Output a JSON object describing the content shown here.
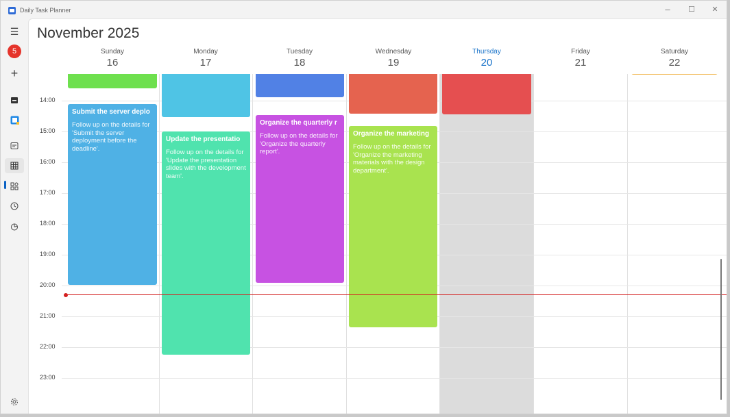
{
  "app": {
    "title": "Daily Task Planner"
  },
  "window_controls": {
    "minimize": "–",
    "maximize": "☐",
    "close": "✕"
  },
  "nav": {
    "menu_icon": "☰",
    "badge": "5",
    "add_icon": "+",
    "items": [
      {
        "icon": "calendar-today-icon"
      },
      {
        "icon": "google-calendar-icon"
      },
      {
        "icon": "agenda-icon"
      },
      {
        "icon": "week-grid-icon",
        "selected": true
      },
      {
        "icon": "widgets-icon"
      },
      {
        "icon": "clock-icon"
      },
      {
        "icon": "pie-chart-icon"
      }
    ],
    "settings_icon": "gear-icon"
  },
  "calendar": {
    "month_label": "November 2025",
    "days": [
      {
        "name": "Sunday",
        "num": "16"
      },
      {
        "name": "Monday",
        "num": "17"
      },
      {
        "name": "Tuesday",
        "num": "18"
      },
      {
        "name": "Wednesday",
        "num": "19"
      },
      {
        "name": "Thursday",
        "num": "20",
        "today": true
      },
      {
        "name": "Friday",
        "num": "21"
      },
      {
        "name": "Saturday",
        "num": "22"
      }
    ],
    "times": [
      "14:00",
      "15:00",
      "16:00",
      "17:00",
      "18:00",
      "19:00",
      "20:00",
      "21:00",
      "22:00",
      "23:00"
    ],
    "current_time_line": true
  },
  "events": [
    {
      "day": "Sunday",
      "title": "",
      "description": "",
      "color": "#6ee04e"
    },
    {
      "day": "Sunday",
      "title": "Submit the server deplo",
      "description": "Follow up on the details for 'Submit the server deployment before the deadline'.",
      "color": "#4fb1e5"
    },
    {
      "day": "Monday",
      "title": "",
      "description": "",
      "color": "#4fc4e5"
    },
    {
      "day": "Monday",
      "title": "Update the presentatio",
      "description": "Follow up on the details for 'Update the presentation slides with the development team'.",
      "color": "#50e3ae"
    },
    {
      "day": "Tuesday",
      "title": "",
      "description": "",
      "color": "#5181e5"
    },
    {
      "day": "Tuesday",
      "title": "Organize the quarterly r",
      "description": "Follow up on the details for 'Organize the quarterly report'.",
      "color": "#c752e2"
    },
    {
      "day": "Wednesday",
      "title": "",
      "description": "",
      "color": "#e5634f"
    },
    {
      "day": "Wednesday",
      "title": "Organize the marketing",
      "description": "Follow up on the details for 'Organize the marketing materials with the design department'.",
      "color": "#a9e34f"
    },
    {
      "day": "Thursday",
      "title": "",
      "description": "",
      "color": "#e54f50"
    },
    {
      "day": "Saturday",
      "title": "",
      "description": "",
      "color": "#f0b54a"
    }
  ]
}
